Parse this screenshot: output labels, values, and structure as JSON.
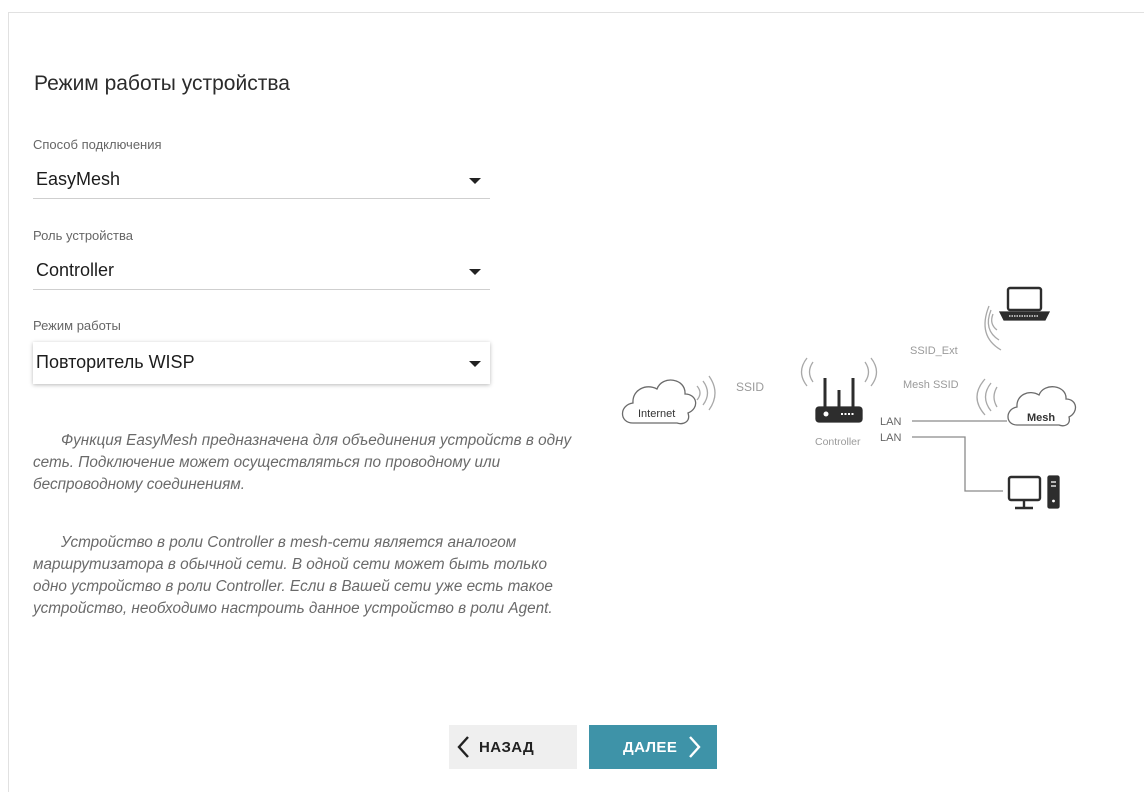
{
  "page": {
    "title": "Режим работы устройства"
  },
  "form": {
    "connection": {
      "label": "Способ подключения",
      "value": "EasyMesh"
    },
    "role": {
      "label": "Роль устройства",
      "value": "Controller"
    },
    "mode": {
      "label": "Режим работы",
      "value": "Повторитель WISP"
    }
  },
  "description": {
    "paragraph1": "Функция EasyMesh предназначена для объединения устройств в одну сеть. Подключение может осуществляться по проводному или беспроводному соединениям.",
    "paragraph2": "Устройство в роли Controller в mesh-сети является аналогом маршрутизатора в обычной сети. В одной сети может быть только одно устройство в роли Controller. Если в Вашей сети уже есть такое устройство, необходимо настроить данное устройство в роли Agent."
  },
  "diagram": {
    "internet": "Internet",
    "ssid": "SSID",
    "controller": "Controller",
    "ssid_ext": "SSID_Ext",
    "mesh_ssid": "Mesh SSID",
    "mesh": "Mesh",
    "lan1": "LAN",
    "lan2": "LAN"
  },
  "buttons": {
    "back": "НАЗАД",
    "next": "ДАЛЕЕ"
  },
  "colors": {
    "accent": "#3e93a8",
    "diagram_stroke": "#6b6b6b",
    "diagram_text": "#9a9a9a"
  }
}
